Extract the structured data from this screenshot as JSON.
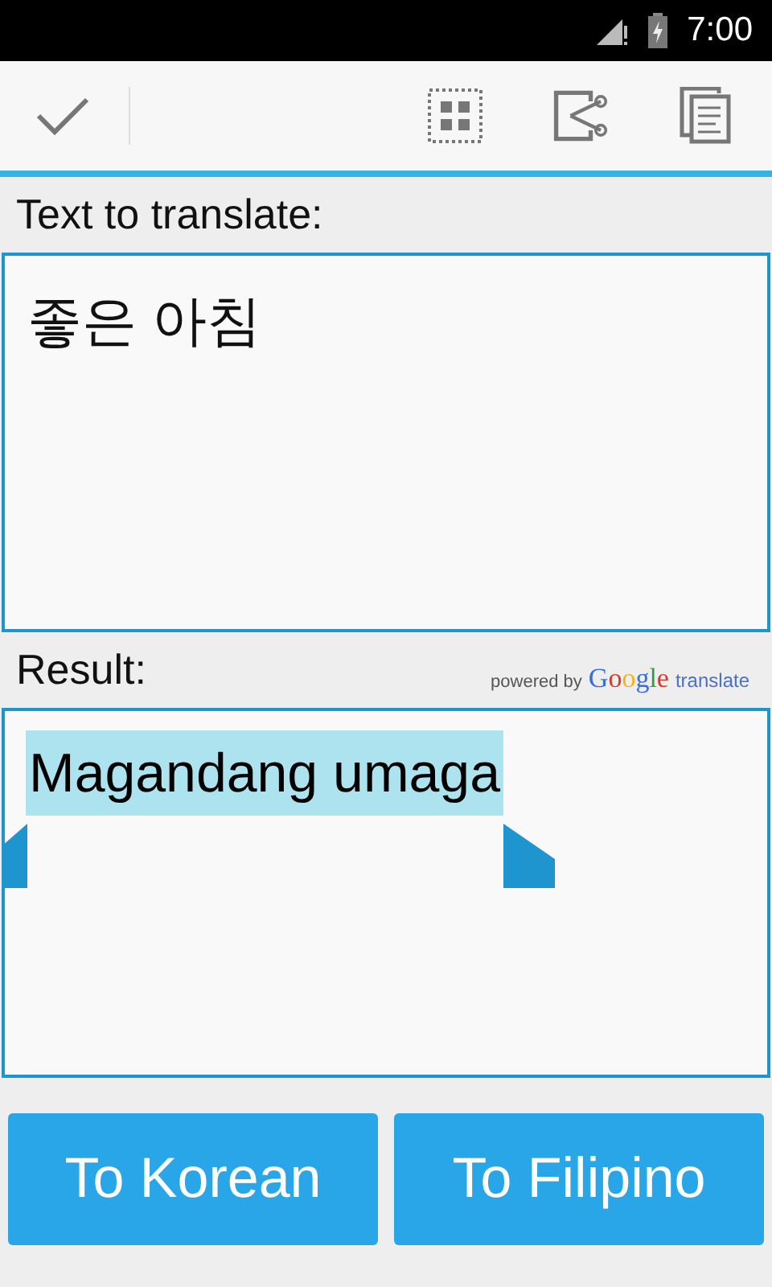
{
  "status_bar": {
    "time": "7:00"
  },
  "source": {
    "label": "Text to translate:",
    "value": "좋은 아침"
  },
  "result": {
    "label": "Result:",
    "powered_by": "powered by",
    "brand": "Google",
    "brand_suffix": "translate",
    "value": "Magandang umaga",
    "selected": true
  },
  "buttons": [
    {
      "label": "To Korean"
    },
    {
      "label": "To Filipino"
    }
  ]
}
